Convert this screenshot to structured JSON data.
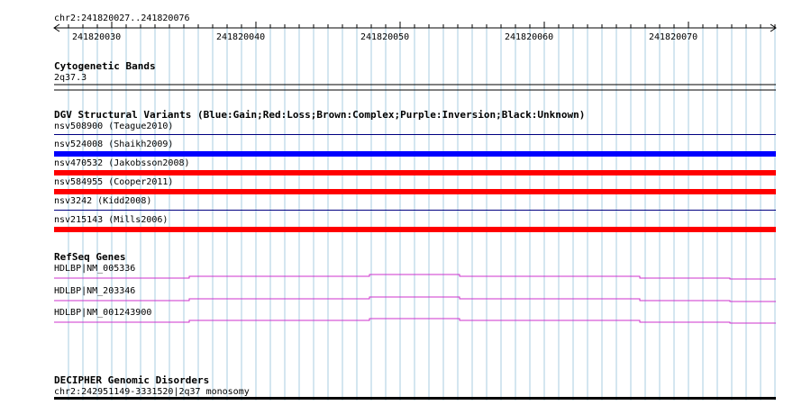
{
  "ruler": {
    "range_label": "chr2:241820027..241820076",
    "tick_labels": [
      "241820030",
      "241820040",
      "241820050",
      "241820060",
      "241820070"
    ]
  },
  "cytoband": {
    "title": "Cytogenetic Bands",
    "band_label": "2q37.3"
  },
  "dgv": {
    "title": "DGV Structural Variants (Blue:Gain;Red:Loss;Brown:Complex;Purple:Inversion;Black:Unknown)",
    "variants": [
      {
        "label": "nsv508900 (Teague2010)",
        "color": "#000080",
        "type": "thin"
      },
      {
        "label": "nsv524008 (Shaikh2009)",
        "color": "#0000ff",
        "type": "thick"
      },
      {
        "label": "nsv470532 (Jakobsson2008)",
        "color": "#ff0000",
        "type": "thick"
      },
      {
        "label": "nsv584955 (Cooper2011)",
        "color": "#ff0000",
        "type": "thick"
      },
      {
        "label": "nsv3242 (Kidd2008)",
        "color": "#000080",
        "type": "thin"
      },
      {
        "label": "nsv215143 (Mills2006)",
        "color": "#ff0000",
        "type": "thick"
      }
    ]
  },
  "refseq": {
    "title": "RefSeq Genes",
    "genes": [
      {
        "label": "HDLBP|NM_005336",
        "color": "#cc33cc"
      },
      {
        "label": "HDLBP|NM_203346",
        "color": "#cc33cc"
      },
      {
        "label": "HDLBP|NM_001243900",
        "color": "#cc33cc"
      }
    ]
  },
  "decipher": {
    "title": "DECIPHER Genomic Disorders",
    "entry_label": "chr2:242951149-3331520|2q37 monosomy",
    "color": "#000000"
  },
  "colors": {
    "gridline": "#a8cce0",
    "ruler_line": "#000000"
  }
}
